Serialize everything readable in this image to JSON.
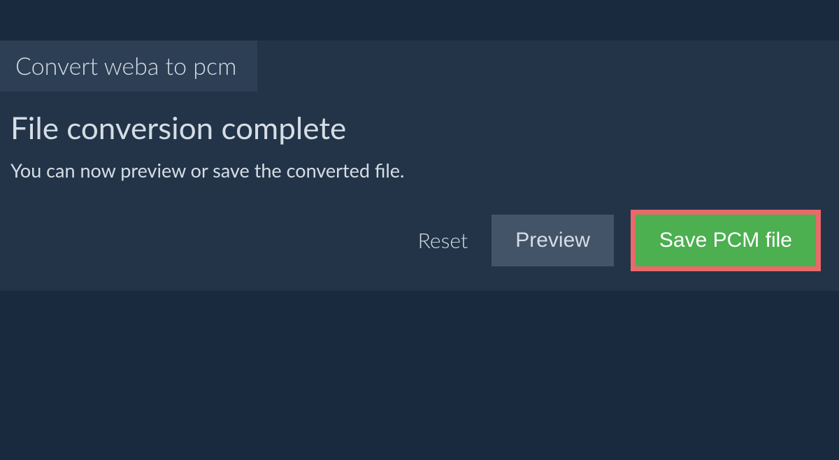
{
  "tab": {
    "label": "Convert weba to pcm"
  },
  "main": {
    "heading": "File conversion complete",
    "subtext": "You can now preview or save the converted file."
  },
  "actions": {
    "reset_label": "Reset",
    "preview_label": "Preview",
    "save_label": "Save PCM file"
  },
  "colors": {
    "highlight_border": "#e86a6a",
    "save_bg": "#4caf50",
    "panel_bg": "#233449",
    "page_bg": "#1a2a3e"
  }
}
